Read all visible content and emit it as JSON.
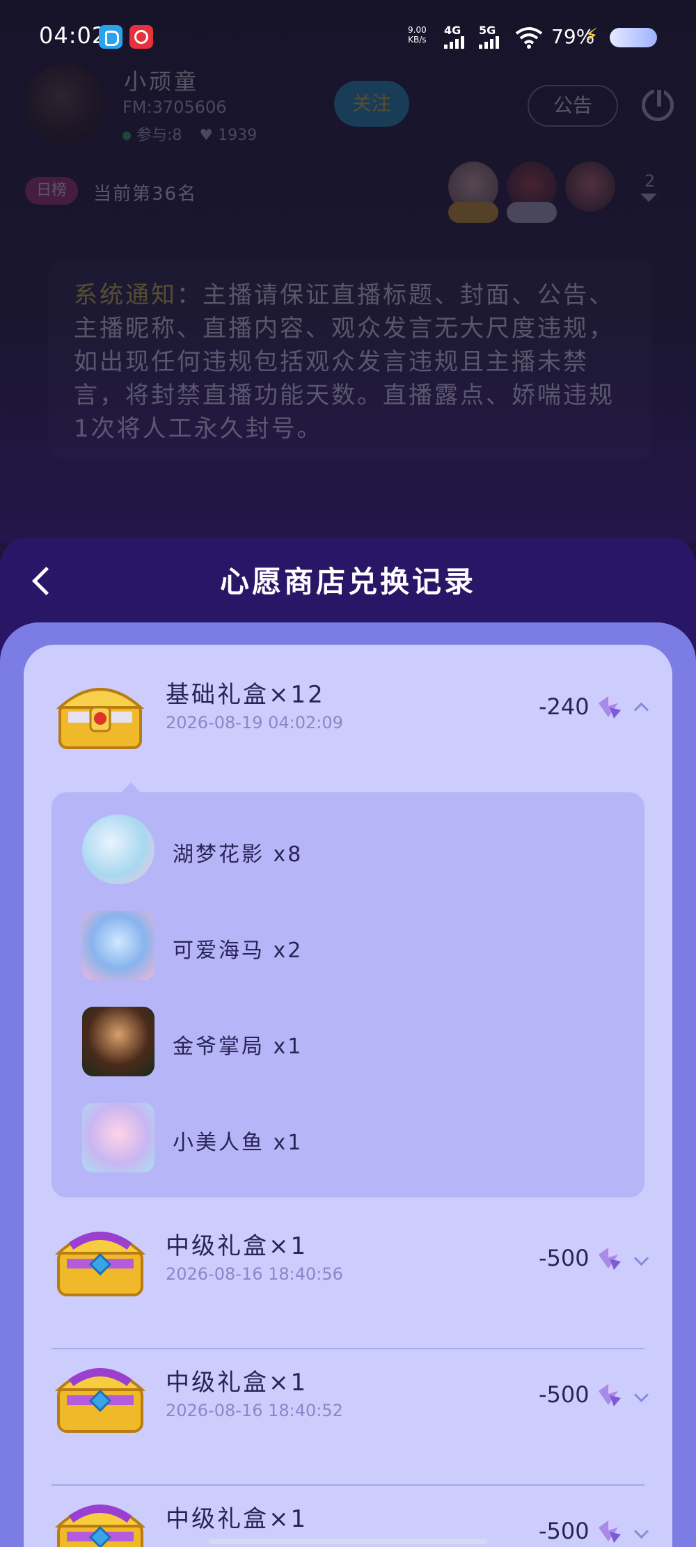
{
  "status_bar": {
    "time": "04:02",
    "net_speed": "9.00",
    "net_speed_unit": "KB/s",
    "net1": "4G",
    "net2": "5G",
    "battery": "79%"
  },
  "room": {
    "host_name": "小顽童",
    "host_id": "FM:3705606",
    "participants": "参与:8",
    "likes": "1939",
    "follow_label": "关注",
    "notice_label": "公告",
    "rank_badge": "日榜",
    "rank_text": "当前第36名",
    "viewer_count": "2",
    "system_notice_label": "系统通知",
    "system_notice_text": "：主播请保证直播标题、封面、公告、主播昵称、直播内容、观众发言无大尺度违规，如出现任何违规包括观众发言违规且主播未禁言，将封禁直播功能天数。直播露点、娇喘违规1次将人工永久封号。"
  },
  "sheet": {
    "title": "心愿商店兑换记录",
    "records": [
      {
        "title": "基础礼盒×12",
        "date": "2026-08-19 04:02:09",
        "amount": "-240",
        "expanded": true,
        "items": [
          {
            "name": "湖梦花影 x8"
          },
          {
            "name": "可爱海马 x2"
          },
          {
            "name": "金爷掌局 x1"
          },
          {
            "name": "小美人鱼 x1"
          }
        ]
      },
      {
        "title": "中级礼盒×1",
        "date": "2026-08-16 18:40:56",
        "amount": "-500",
        "expanded": false
      },
      {
        "title": "中级礼盒×1",
        "date": "2026-08-16 18:40:52",
        "amount": "-500",
        "expanded": false
      },
      {
        "title": "中级礼盒×1",
        "date": "",
        "amount": "-500",
        "expanded": false
      }
    ]
  },
  "colors": {
    "sheet_header": "#2a1666",
    "sheet_body": "#7b7de4",
    "card": "#cccdfc",
    "detail": "#b5b5f7",
    "text": "#2a2358",
    "date": "#8b86c9"
  }
}
